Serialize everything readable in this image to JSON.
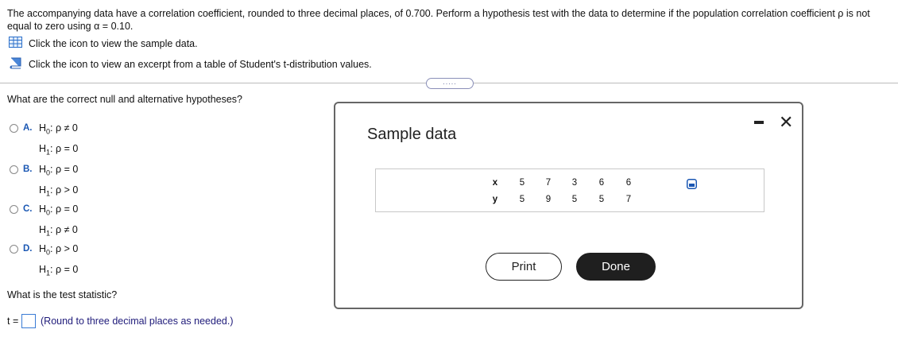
{
  "problem": {
    "text": "The accompanying data have a correlation coefficient, rounded to three decimal places, of 0.700. Perform a hypothesis test with the data to determine if the population correlation coefficient ρ is not equal to zero using α = 0.10."
  },
  "links": {
    "sample_data": "Click the icon to view the sample data.",
    "t_table": "Click the icon to view an excerpt from a table of Student's t-distribution values."
  },
  "more_indicator": ".....",
  "question1": {
    "text": "What are the correct null and alternative hypotheses?",
    "options": [
      {
        "letter": "A.",
        "h0": ": ρ ≠ 0",
        "h1": ": ρ = 0"
      },
      {
        "letter": "B.",
        "h0": ": ρ = 0",
        "h1": ": ρ > 0"
      },
      {
        "letter": "C.",
        "h0": ": ρ = 0",
        "h1": ": ρ ≠ 0"
      },
      {
        "letter": "D.",
        "h0": ": ρ > 0",
        "h1": ": ρ = 0"
      }
    ]
  },
  "hyp_labels": {
    "h": "H",
    "sub0": "0",
    "sub1": "1"
  },
  "question2": {
    "text": "What is the test statistic?",
    "prefix": "t =",
    "hint": "(Round to three decimal places as needed.)"
  },
  "modal": {
    "title": "Sample data",
    "table": {
      "row_x_label": "x",
      "row_y_label": "y",
      "x": [
        "5",
        "7",
        "3",
        "6",
        "6"
      ],
      "y": [
        "5",
        "9",
        "5",
        "5",
        "7"
      ]
    },
    "print_label": "Print",
    "done_label": "Done"
  },
  "colors": {
    "accent": "#1a57b3",
    "hint": "#1f1b7a",
    "done_bg": "#1f1f1f"
  },
  "icons": [
    "table-icon",
    "book-icon",
    "minimize-icon",
    "close-icon",
    "copy-icon"
  ]
}
